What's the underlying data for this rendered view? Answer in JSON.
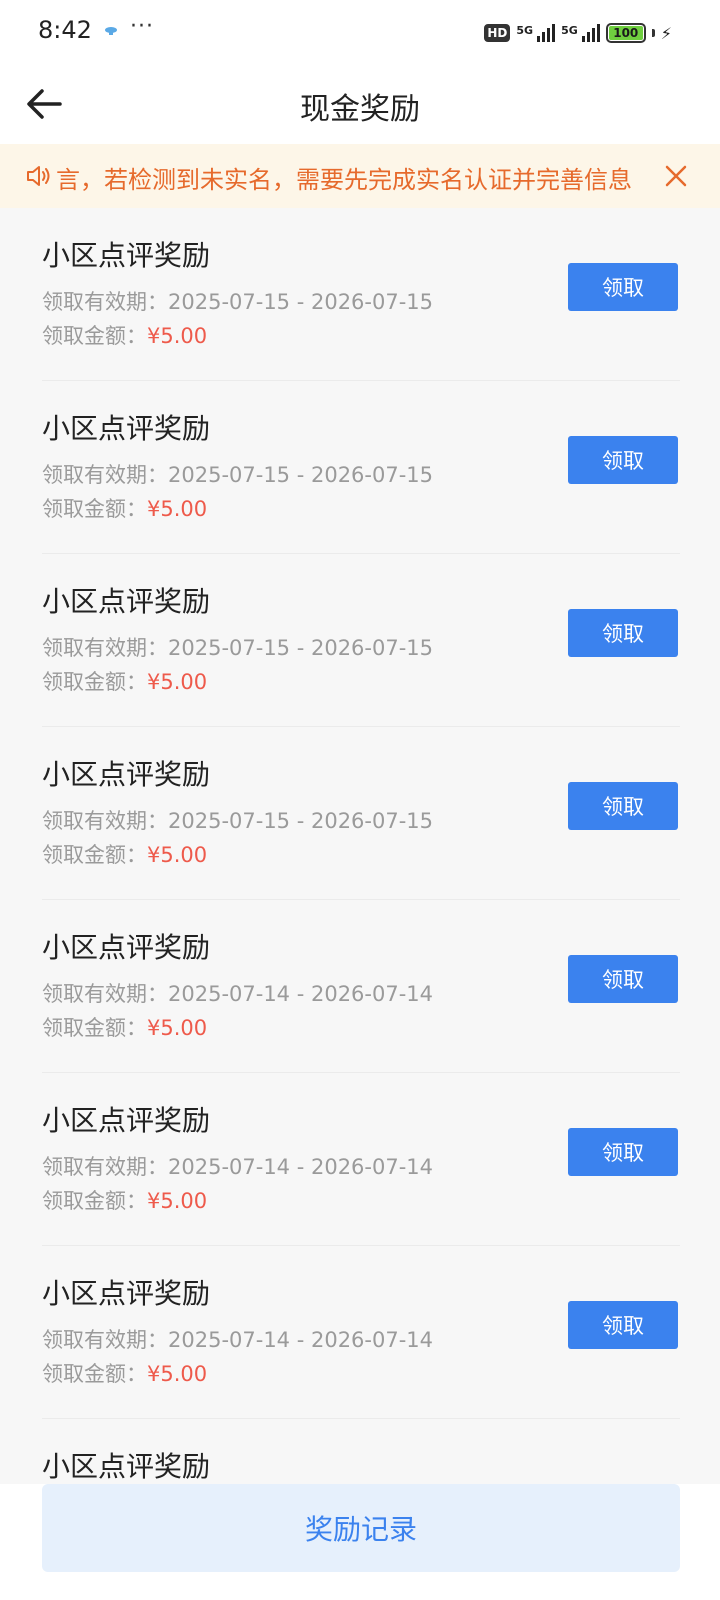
{
  "status_bar": {
    "time": "8:42",
    "more": "···",
    "hd": "HD",
    "net1": "5G",
    "net2": "5G",
    "battery": "100"
  },
  "header": {
    "title": "现金奖励"
  },
  "notice": {
    "text": "言，若检测到未实名，需要先完成实名认证并完善信息",
    "text_color": "#e66a2c",
    "background": "#fdf6e8"
  },
  "rewards": {
    "validity_label": "领取有效期：",
    "amount_label": "领取金额：",
    "claim_label": "领取",
    "items": [
      {
        "title": "小区点评奖励",
        "validity": "2025-07-15 - 2026-07-15",
        "amount": "¥5.00"
      },
      {
        "title": "小区点评奖励",
        "validity": "2025-07-15 - 2026-07-15",
        "amount": "¥5.00"
      },
      {
        "title": "小区点评奖励",
        "validity": "2025-07-15 - 2026-07-15",
        "amount": "¥5.00"
      },
      {
        "title": "小区点评奖励",
        "validity": "2025-07-15 - 2026-07-15",
        "amount": "¥5.00"
      },
      {
        "title": "小区点评奖励",
        "validity": "2025-07-14 - 2026-07-14",
        "amount": "¥5.00"
      },
      {
        "title": "小区点评奖励",
        "validity": "2025-07-14 - 2026-07-14",
        "amount": "¥5.00"
      },
      {
        "title": "小区点评奖励",
        "validity": "2025-07-14 - 2026-07-14",
        "amount": "¥5.00"
      },
      {
        "title": "小区点评奖励",
        "validity": "",
        "amount": ""
      }
    ]
  },
  "footer": {
    "records_label": "奖励记录"
  },
  "colors": {
    "accent": "#3b82ee",
    "amount": "#ee5a4b",
    "secondary_text": "#9a9a9a"
  }
}
